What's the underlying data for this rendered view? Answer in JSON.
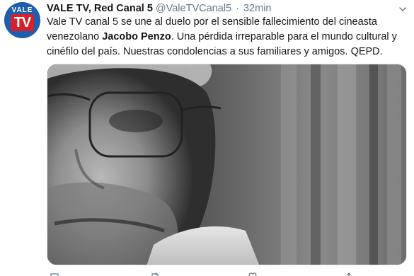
{
  "tweet": {
    "author_name": "VALE TV, Red Canal 5",
    "handle": "@ValeTVCanal5",
    "separator": "·",
    "time": "32min",
    "avatar": {
      "logo_top": "VALE",
      "logo_tv": "TV",
      "colors": {
        "background": "#1f5fb0",
        "tv_box": "#d6202a"
      }
    },
    "text_part1": "Vale TV canal 5 se une al duelo por el sensible fallecimiento del cineasta venezolano ",
    "text_bold": "Jacobo Penzo",
    "text_part2": ".  Una pérdida irreparable para el mundo cultural y cinéfilo del país.  Nuestras condolencias a sus familiares y amigos.  QEPD.",
    "menu_icon": "chevron-down-icon",
    "media": {
      "kind": "black-and-white close-up portrait photo of a man wearing glasses"
    },
    "actions": [
      "reply-icon",
      "retweet-icon",
      "like-icon",
      "share-icon"
    ]
  },
  "colors": {
    "text": "#14171a",
    "secondary": "#657786",
    "border": "#e1e8ed"
  }
}
